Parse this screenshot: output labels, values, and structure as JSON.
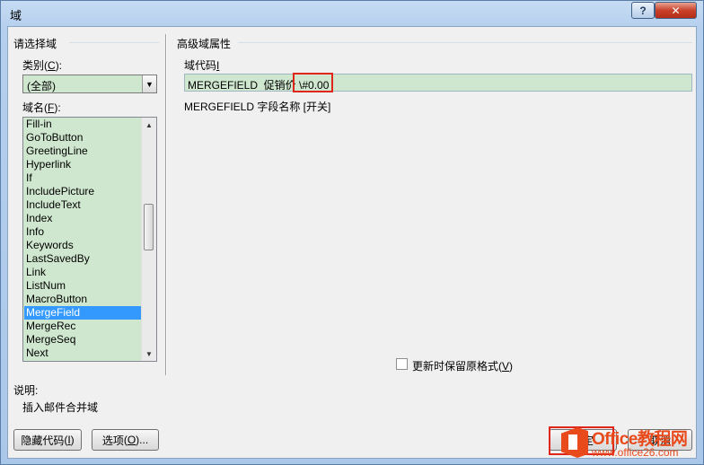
{
  "window": {
    "title": "域"
  },
  "titlebar": {
    "help_glyph": "?",
    "close_glyph": "✕"
  },
  "left": {
    "group_title": "请选择域",
    "category_label": "类别",
    "category_key": "C",
    "category_value": "(全部)",
    "field_names_label": "域名",
    "field_names_key": "F",
    "field_names": [
      "Fill-in",
      "GoToButton",
      "GreetingLine",
      "Hyperlink",
      "If",
      "IncludePicture",
      "IncludeText",
      "Index",
      "Info",
      "Keywords",
      "LastSavedBy",
      "Link",
      "ListNum",
      "MacroButton",
      "MergeField",
      "MergeRec",
      "MergeSeq",
      "Next"
    ],
    "selected_item": "MergeField",
    "description_label": "说明:",
    "description_text": "插入邮件合并域"
  },
  "right": {
    "group_title": "高级域属性",
    "field_code_label": "域代码",
    "field_code_key": "I",
    "field_code_value": "MERGEFIELD  促销价 \\#0.00",
    "syntax_hint": "MERGEFIELD 字段名称 [开关]",
    "preserve_format_label": "更新时保留原格式",
    "preserve_format_key": "V",
    "preserve_format_checked": false
  },
  "buttons": {
    "hide_codes_label": "隐藏代码",
    "hide_codes_key": "I",
    "options_label": "选项",
    "options_key": "O",
    "ok_label": "确定",
    "cancel_label": "取消"
  },
  "watermark": {
    "brand": "Office教程网",
    "url": "www.office26.com"
  },
  "colors": {
    "field_bg": "#cfe7cf",
    "selection": "#3399ff",
    "highlight": "#e0251b",
    "watermark": "#e84a1c"
  }
}
